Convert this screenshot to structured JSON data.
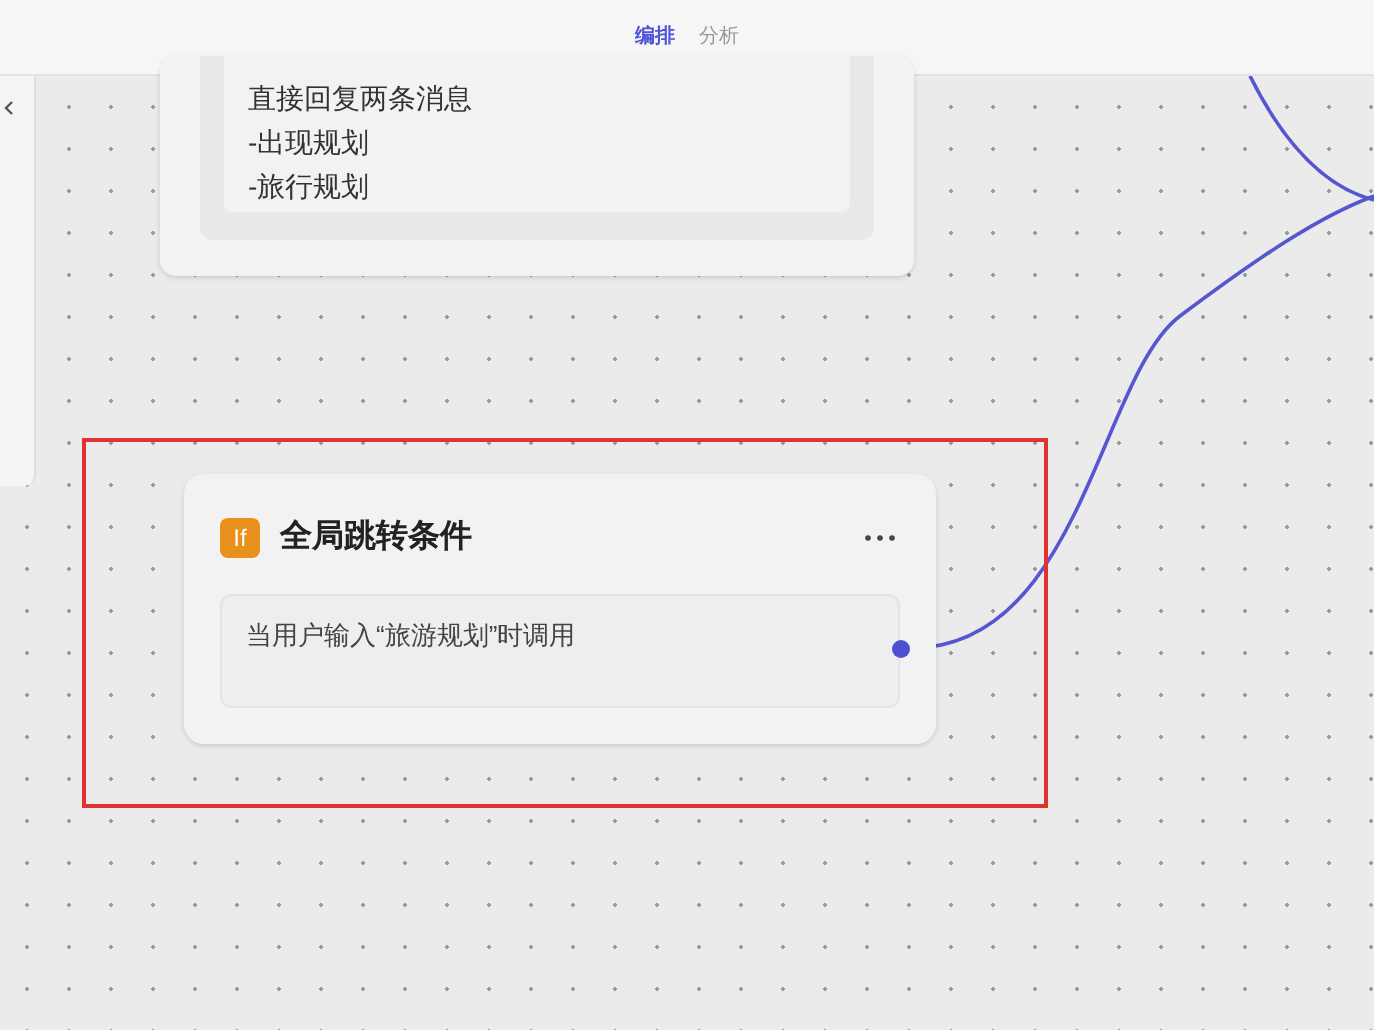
{
  "tabs": [
    {
      "label": "编排",
      "selected": true
    },
    {
      "label": "分析",
      "selected": false
    }
  ],
  "message_node": {
    "lines": [
      "直接回复两条消息",
      "-出现规划",
      "-旅行规划"
    ]
  },
  "condition_node": {
    "badge": "If",
    "title": "全局跳转条件",
    "description": "当用户输入“旅游规划”时调用",
    "selected": true
  }
}
